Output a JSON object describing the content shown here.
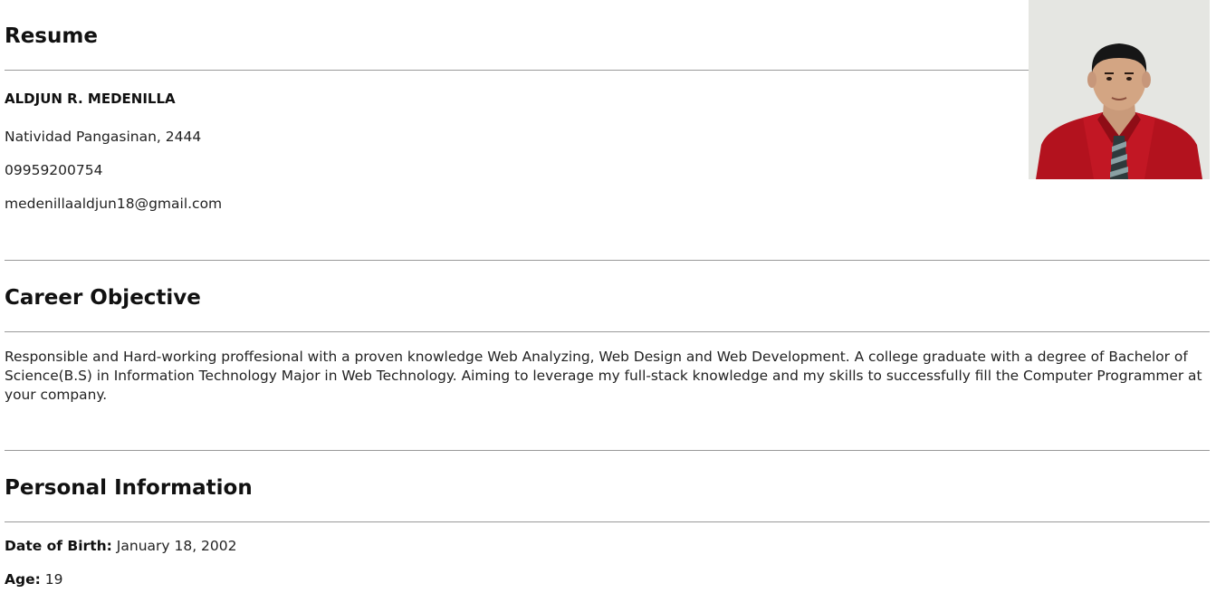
{
  "header": {
    "title": "Resume",
    "name": "ALDJUN R. MEDENILLA",
    "address": "Natividad Pangasinan, 2444",
    "phone": "09959200754",
    "email": "medenillaaldjun18@gmail.com"
  },
  "career": {
    "title": "Career Objective",
    "text": "Responsible and Hard-working proffesional with a proven knowledge Web Analyzing, Web Design and Web Development. A college graduate with a degree of Bachelor of Science(B.S) in Information Technology Major in Web Technology. Aiming to leverage my full-stack knowledge and my skills to successfully fill the Computer Programmer at your company."
  },
  "personal": {
    "title": "Personal Information",
    "dob_label": "Date of Birth:",
    "dob_value": "January 18, 2002",
    "age_label": "Age:",
    "age_value": "19"
  },
  "colors": {
    "shirt": "#b3121e",
    "background": "#ffffff",
    "rule": "#9a9a9a"
  }
}
